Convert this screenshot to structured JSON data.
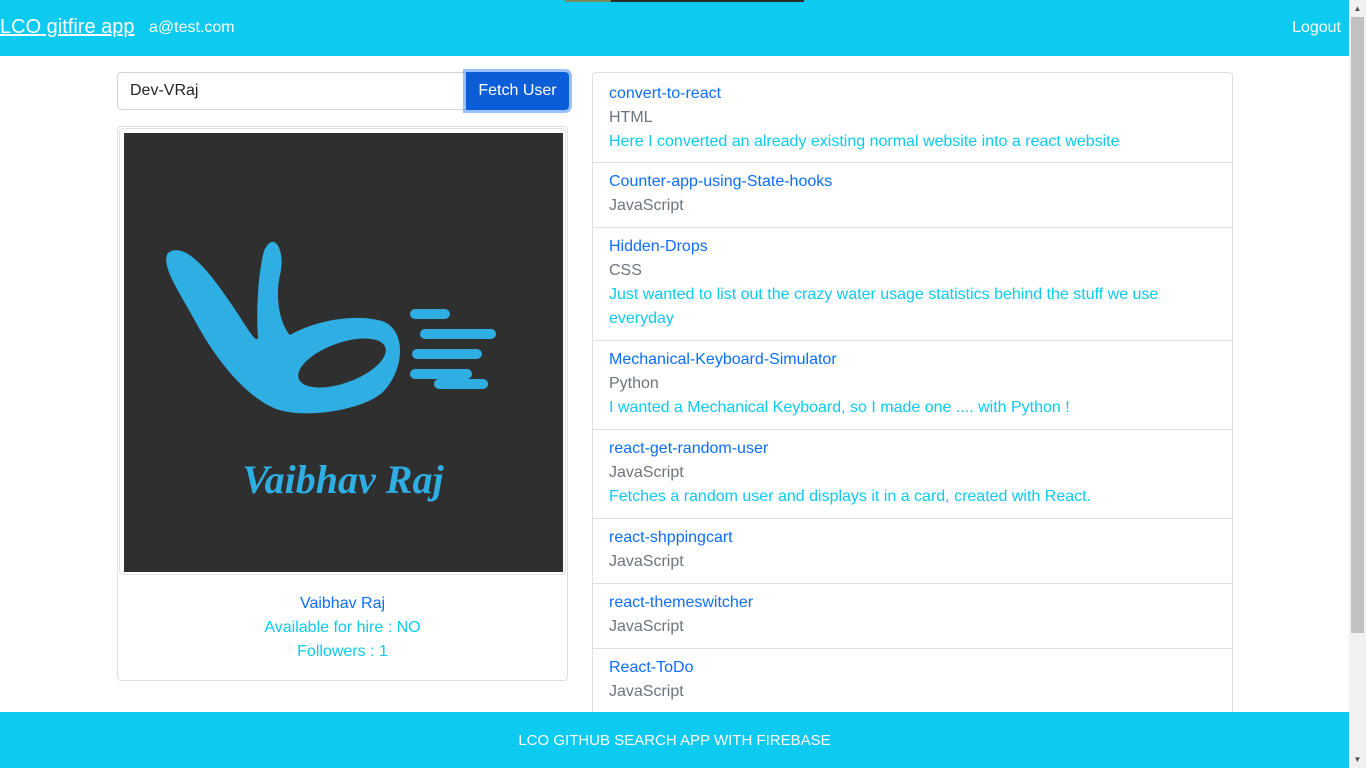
{
  "navbar": {
    "brand": "LCO gitfire app",
    "email": "a@test.com",
    "logout": "Logout"
  },
  "search": {
    "value": "Dev-VRaj",
    "button": "Fetch User"
  },
  "user_card": {
    "avatar_text": "Vaibhav Raj",
    "name": "Vaibhav Raj",
    "hire": "Available for hire : NO",
    "followers": "Followers : 1"
  },
  "repos": [
    {
      "name": "convert-to-react",
      "language": "HTML",
      "description": "Here I converted an already existing normal website into a react website"
    },
    {
      "name": "Counter-app-using-State-hooks",
      "language": "JavaScript",
      "description": ""
    },
    {
      "name": "Hidden-Drops",
      "language": "CSS",
      "description": "Just wanted to list out the crazy water usage statistics behind the stuff we use everyday"
    },
    {
      "name": "Mechanical-Keyboard-Simulator",
      "language": "Python",
      "description": "I wanted a Mechanical Keyboard, so I made one .... with Python !"
    },
    {
      "name": "react-get-random-user",
      "language": "JavaScript",
      "description": "Fetches a random user and displays it in a card, created with React."
    },
    {
      "name": "react-shppingcart",
      "language": "JavaScript",
      "description": ""
    },
    {
      "name": "react-themeswitcher",
      "language": "JavaScript",
      "description": ""
    },
    {
      "name": "React-ToDo",
      "language": "JavaScript",
      "description": ""
    }
  ],
  "footer": {
    "text": "LCO GITHUB SEARCH APP WITH FIREBASE"
  },
  "colors": {
    "navbar": "#0dcaf0",
    "button": "#0b5ed7",
    "link": "#0d6efd",
    "avatar_bg": "#2f2f2f",
    "logo_blue": "#2eaee3"
  },
  "icons": {
    "scroll_up": "scroll-up-arrow-icon",
    "scroll_down": "scroll-down-arrow-icon"
  }
}
